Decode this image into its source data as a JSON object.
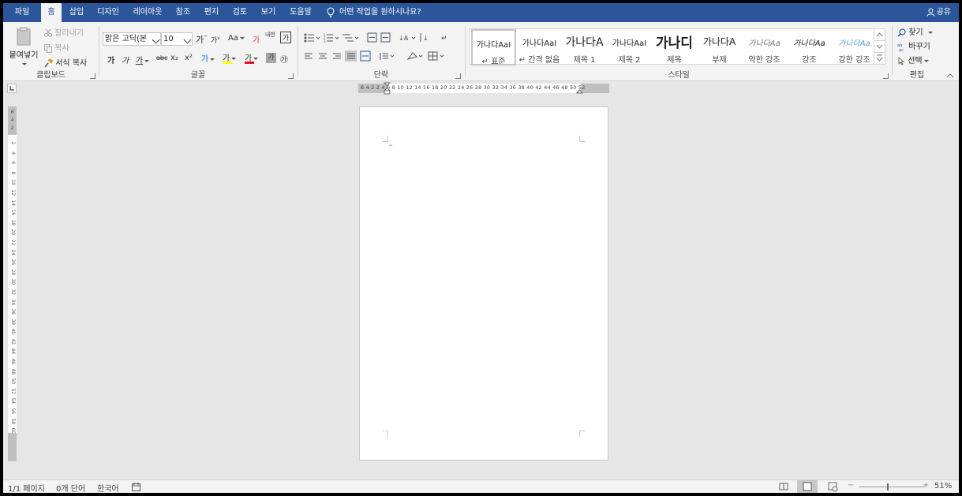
{
  "tabs": [
    "파일",
    "홈",
    "삽입",
    "디자인",
    "레이아웃",
    "참조",
    "편지",
    "검토",
    "보기",
    "도움말"
  ],
  "active_tab": "홈",
  "tell_me": "어떤 작업을 원하시나요?",
  "share": "공유",
  "clipboard": {
    "label": "클립보드",
    "paste": "붙여넣기",
    "cut": "잘라내기",
    "copy": "복사",
    "format_painter": "서식 복사"
  },
  "font": {
    "label": "글꼴",
    "family": "맑은 고딕(본",
    "size": "10",
    "grow": "가",
    "shrink": "가",
    "case": "Aa",
    "bold": "가",
    "italic": "가",
    "underline": "가",
    "strike": "abc",
    "sub": "x₂",
    "sup": "x²",
    "font_color_glyph": "가",
    "highlight_glyph": "가",
    "char_shading": "가",
    "enclose": "㉮",
    "phonetic": "가",
    "clear": "가",
    "phonetic_top": "내천"
  },
  "paragraph": {
    "label": "단락"
  },
  "styles": {
    "label": "스타일",
    "items": [
      {
        "preview": "가나다AaI",
        "name": "↵ 표준"
      },
      {
        "preview": "가나다AaI",
        "name": "↵ 간격 없음"
      },
      {
        "preview": "가나다A",
        "name": "제목 1"
      },
      {
        "preview": "가나다AaI",
        "name": "제목 2"
      },
      {
        "preview": "가나디",
        "name": "제목"
      },
      {
        "preview": "가나다A",
        "name": "부제"
      },
      {
        "preview": "가나다Aa",
        "name": "약한 강조"
      },
      {
        "preview": "가나다Aa",
        "name": "강조"
      },
      {
        "preview": "가나다Aa",
        "name": "강한 강조"
      }
    ]
  },
  "editing": {
    "label": "편집",
    "find": "찾기",
    "replace": "바꾸기",
    "select": "선택"
  },
  "ruler": {
    "horizontal": "6 4 2   2 4 6 8 10 12 14 16 18 20 22 24 26 28 30 32 34 36 38 40 42 44 46 48 50 52",
    "vertical": [
      "2",
      "4",
      "6",
      "8",
      "10",
      "12",
      "14",
      "16",
      "18",
      "20",
      "22",
      "24",
      "26",
      "28",
      "30",
      "32",
      "34",
      "36",
      "38",
      "40",
      "42",
      "44",
      "46",
      "48",
      "50",
      "52",
      "54",
      "56",
      "58",
      "60"
    ],
    "vertical_top": [
      "6",
      "4",
      "2"
    ]
  },
  "status": {
    "page": "1/1 페이지",
    "words": "0개 단어",
    "language": "한국어",
    "zoom": "51%"
  },
  "colors": {
    "tabbar": "#2b579a",
    "ribbon": "#f3f3f3",
    "canvas": "#e6e6e6",
    "font_color_bar": "#e81123",
    "highlight_bar": "#ffff00",
    "emphasis_style": "#5b9bd5"
  },
  "icons": [
    "lightbulb-icon",
    "person-icon",
    "clipboard-icon",
    "scissors-icon",
    "copy-icon",
    "brush-icon",
    "search-icon",
    "replace-icon",
    "cursor-icon"
  ]
}
